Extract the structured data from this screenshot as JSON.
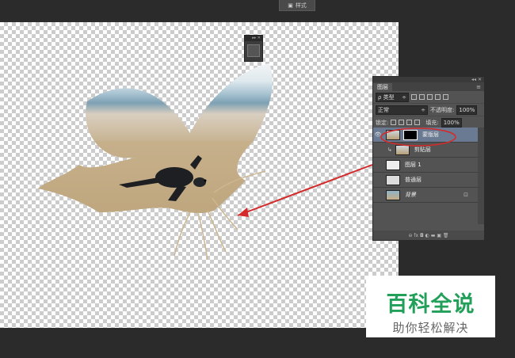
{
  "top_button": {
    "label": "样式"
  },
  "mini_panel": {
    "bar": "▸▸ ✕",
    "icon": "layer-style-icon"
  },
  "layers_panel": {
    "top_bar": "◂◂ ✕",
    "tab": "图层",
    "tab_menu": "≡",
    "filter": {
      "label": "ρ 类型",
      "arrow": "÷"
    },
    "blend": {
      "mode": "正常",
      "arrow": "÷",
      "opacity_label": "不透明度:",
      "opacity_value": "100%"
    },
    "lock": {
      "label": "锁定:",
      "fill_label": "填充:",
      "fill_value": "100%"
    },
    "layers": [
      {
        "name": "蒙版层",
        "visible": true,
        "active": true
      },
      {
        "name": "剪贴层",
        "visible": false,
        "active": false
      },
      {
        "name": "图层 1",
        "visible": false,
        "active": false
      },
      {
        "name": "普通层",
        "visible": false,
        "active": false
      },
      {
        "name": "背景",
        "visible": false,
        "active": false,
        "locked": true
      }
    ],
    "bottom_icons": "⊖ fx ◘ ◐ ▬ ▣ 🗑"
  },
  "watermark": {
    "title": "百科全说",
    "subtitle": "助你轻松解决"
  },
  "colors": {
    "annotation": "#d42a2a",
    "watermark_green": "#22a05a",
    "panel_bg": "#535353",
    "active_layer": "#6a7a92"
  }
}
